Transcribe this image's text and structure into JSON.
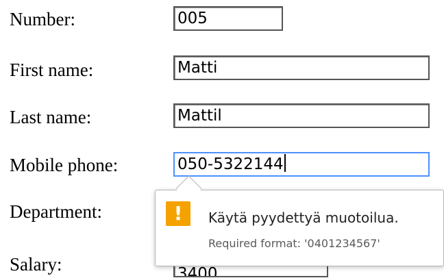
{
  "form": {
    "number_label": "Number:",
    "number_value": "005",
    "first_name_label": "First name:",
    "first_name_value": "Matti",
    "last_name_label": "Last name:",
    "last_name_value": "Mattil",
    "mobile_label": "Mobile phone:",
    "mobile_value": "050-5322144",
    "department_label": "Department:",
    "department_value": "",
    "salary_label": "Salary:",
    "salary_value": "3400"
  },
  "validation_tooltip": {
    "icon": "warning-exclamation-icon",
    "icon_glyph": "!",
    "message": "Käytä pyydettyä muotoilua.",
    "detail": "Required format: '0401234567'"
  },
  "colors": {
    "focus_border": "#4d90fe",
    "warning": "#f5a200"
  }
}
